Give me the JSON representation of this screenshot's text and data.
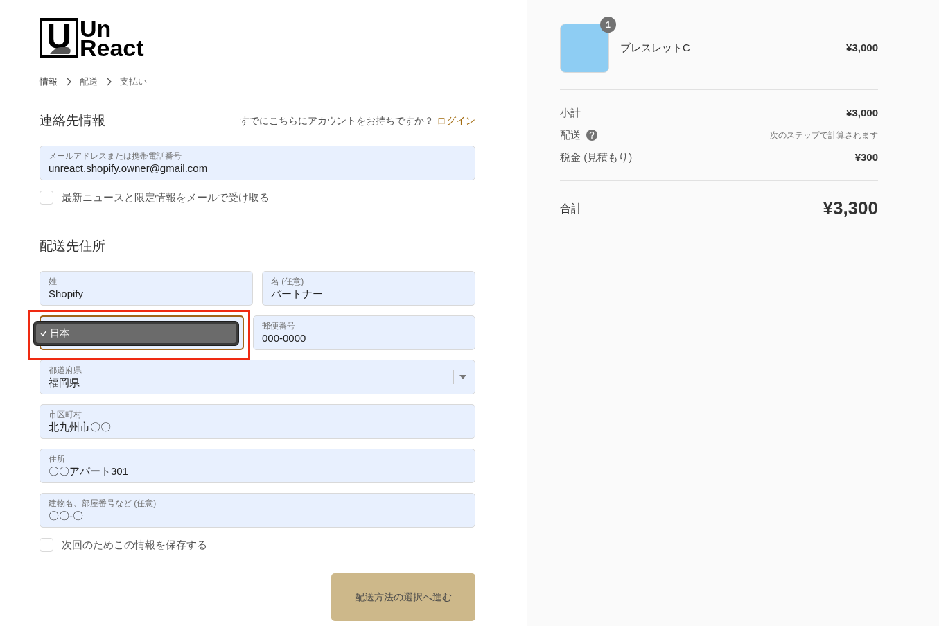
{
  "logo": {
    "mark": "U",
    "line1": "Un",
    "line2": "React"
  },
  "breadcrumbs": [
    {
      "label": "情報",
      "selected": true
    },
    {
      "label": "配送",
      "selected": false
    },
    {
      "label": "支払い",
      "selected": false
    }
  ],
  "contact": {
    "title": "連絡先情報",
    "login_prompt": "すでにこちらにアカウントをお持ちですか？",
    "login_link": "ログイン",
    "email": {
      "label": "メールアドレスまたは携帯電話番号",
      "value": "unreact.shopify.owner@gmail.com"
    },
    "newsletter": {
      "label": "最新ニュースと限定情報をメールで受け取る",
      "checked": false
    }
  },
  "shipping": {
    "title": "配送先住所",
    "rows": [
      [
        {
          "kind": "text",
          "label": "姓",
          "value": "Shopify"
        },
        {
          "kind": "text",
          "label": "名 (任意)",
          "value": "パートナー"
        }
      ],
      [
        {
          "kind": "popup",
          "option": "日本",
          "selected": true,
          "highlighted": true
        },
        {
          "kind": "text",
          "label": "郵便番号",
          "value": "000-0000"
        }
      ],
      [
        {
          "kind": "select",
          "label": "都道府県",
          "value": "福岡県"
        }
      ],
      [
        {
          "kind": "text",
          "label": "市区町村",
          "value": "北九州市〇〇"
        }
      ],
      [
        {
          "kind": "text",
          "label": "住所",
          "value": "〇〇アパート301"
        }
      ],
      [
        {
          "kind": "text",
          "label": "建物名、部屋番号など (任意)",
          "value": "〇〇-〇"
        }
      ]
    ],
    "save_info": {
      "label": "次回のためこの情報を保存する",
      "checked": false
    },
    "continue_button": "配送方法の選択へ進む"
  },
  "summary": {
    "items": [
      {
        "name": "ブレスレットC",
        "quantity": "1",
        "price": "¥3,000"
      }
    ],
    "lines": [
      {
        "kind": "plain",
        "label": "小計",
        "value": "¥3,000"
      },
      {
        "kind": "help",
        "label": "配送",
        "value": "次のステップで計算されます"
      },
      {
        "kind": "plain",
        "label": "税金 (見積もり)",
        "value": "¥300"
      }
    ],
    "total": {
      "label": "合計",
      "value": "¥3,300"
    }
  }
}
